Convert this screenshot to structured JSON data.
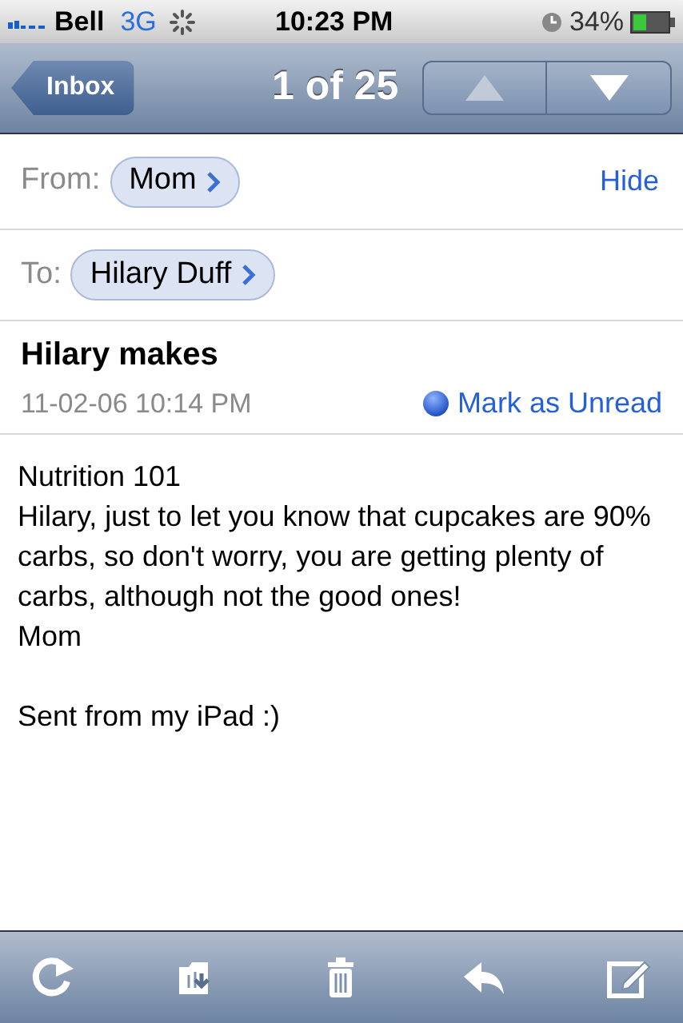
{
  "status_bar": {
    "carrier": "Bell",
    "network": "3G",
    "time": "10:23 PM",
    "battery": "34%"
  },
  "nav_bar": {
    "back": "Inbox",
    "title": "1 of 25",
    "buttons": [
      {
        "kind": "up",
        "disabled": true
      },
      {
        "kind": "down",
        "disabled": false
      }
    ]
  },
  "from": {
    "label": "From:",
    "name": "Mom",
    "action": "Hide"
  },
  "to": {
    "label": "To:",
    "name": "Hilary Duff"
  },
  "subject": "Hilary makes",
  "date": "11-02-06 10:14 PM",
  "mark_unread": "Mark as Unread",
  "body": [
    [
      "Nutrition 101",
      "Hilary, just to let you know that cupcakes are 90% carbs, so don't worry, you are getting plenty of carbs, although not the good ones!",
      "Mom"
    ],
    [
      "Sent from my iPad :)"
    ]
  ],
  "toolbar": [
    {
      "kind": "refresh"
    },
    {
      "kind": "move"
    },
    {
      "kind": "trash"
    },
    {
      "kind": "reply"
    },
    {
      "kind": "compose"
    }
  ]
}
